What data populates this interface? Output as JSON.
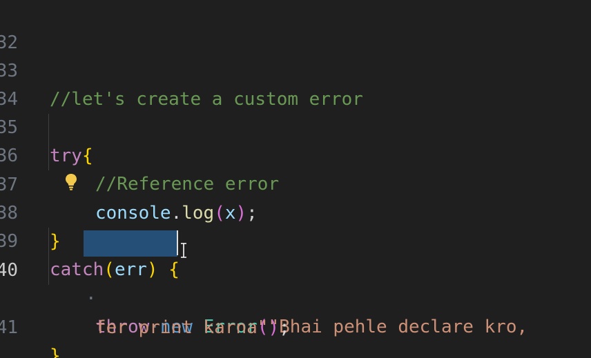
{
  "editor": {
    "language": "javascript",
    "lines": [
      {
        "number": "32",
        "text": ""
      },
      {
        "number": "33",
        "text": "//let's create a custom error"
      },
      {
        "number": "34",
        "text": ""
      },
      {
        "number": "35",
        "text": "try{"
      },
      {
        "number": "36",
        "text": "//Reference error"
      },
      {
        "number": "37",
        "text": "console.log(x);"
      },
      {
        "number": "38",
        "text": "}"
      },
      {
        "number": "39",
        "text": "catch(err) {"
      },
      {
        "number": "40",
        "text": "throw new Error(\"Bhai pehle declare kro,"
      },
      {
        "number": "",
        "text": "fer print karna\");"
      },
      {
        "number": "41",
        "text": "}"
      }
    ],
    "tokens": {
      "comment1": "//let's create a custom error",
      "try_kw": "try",
      "brace_open": "{",
      "comment2": "//Reference error",
      "console": "console",
      "dot": ".",
      "log": "log",
      "paren_open": "(",
      "x": "x",
      "paren_close": ")",
      "semicolon": ";",
      "brace_close": "}",
      "catch_kw": "catch",
      "err": "err",
      "throw_kw": "throw",
      "new_kw": "new",
      "error_type": "Error",
      "string_part1": "\"Bhai pehle declare kro,",
      "string_part2": "fer print karna\"",
      "space_dot": "·"
    },
    "active_line": "40",
    "selection_text": "throw ne",
    "lightbulb_icon": "lightbulb-icon",
    "colors": {
      "background": "#1f1f1f",
      "comment": "#6a9955",
      "keyword": "#c586c0",
      "keyword_blue": "#569cd6",
      "identifier": "#9cdcfe",
      "function": "#dcdcaa",
      "type": "#4ec9b0",
      "string": "#ce9178",
      "bracket_level1": "#ffd700",
      "bracket_level2": "#da70d6",
      "selection": "#264f78"
    }
  }
}
